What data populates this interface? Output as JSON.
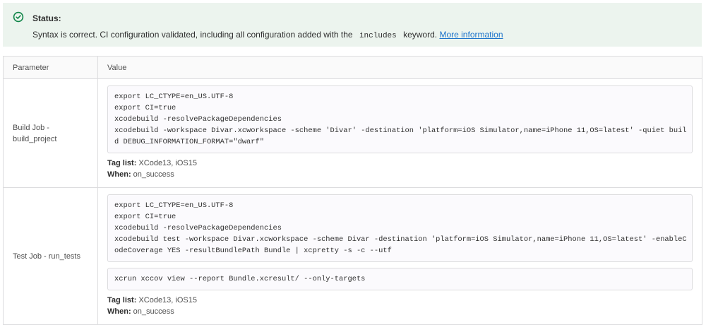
{
  "alert": {
    "title": "Status:",
    "text_before": "Syntax is correct. CI configuration validated, including all configuration added with the",
    "keyword": "includes",
    "text_after": "keyword.",
    "link": "More information"
  },
  "table": {
    "headers": {
      "parameter": "Parameter",
      "value": "Value"
    },
    "jobs": [
      {
        "name_line1": "Build Job -",
        "name_line2": "build_project",
        "script": "export LC_CTYPE=en_US.UTF-8\nexport CI=true\nxcodebuild -resolvePackageDependencies\nxcodebuild -workspace Divar.xcworkspace -scheme 'Divar' -destination 'platform=iOS Simulator,name=iPhone 11,OS=latest' -quiet buil\nd DEBUG_INFORMATION_FORMAT=\"dwarf\"",
        "tag_label": "Tag list:",
        "tag_value": "XCode13, iOS15",
        "when_label": "When:",
        "when_value": "on_success"
      },
      {
        "name_line1": "Test Job - run_tests",
        "script": "export LC_CTYPE=en_US.UTF-8\nexport CI=true\nxcodebuild -resolvePackageDependencies\nxcodebuild test -workspace Divar.xcworkspace -scheme Divar -destination 'platform=iOS Simulator,name=iPhone 11,OS=latest' -enableC\nodeCoverage YES -resultBundlePath Bundle | xcpretty -s -c --utf",
        "after_script": "xcrun xccov view --report Bundle.xcresult/ --only-targets",
        "tag_label": "Tag list:",
        "tag_value": "XCode13, iOS15",
        "when_label": "When:",
        "when_value": "on_success"
      }
    ]
  },
  "colors": {
    "success": "#108548",
    "alert_bg": "#ecf4ee",
    "link": "#1f75cb"
  },
  "icons": {
    "status": "check-circle-icon"
  }
}
